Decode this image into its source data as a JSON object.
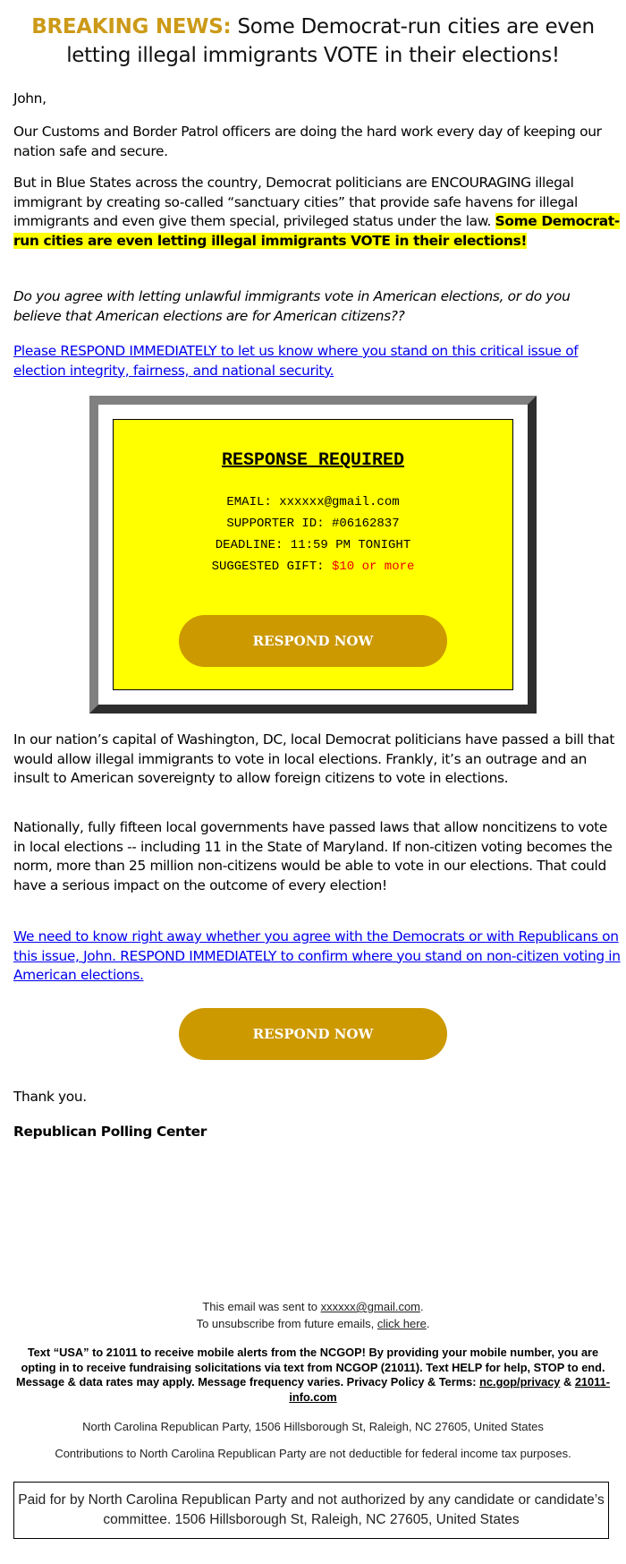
{
  "headline": {
    "prefix": "BREAKING NEWS:",
    "text": "Some Democrat-run cities are even letting illegal immigrants VOTE in their elections!"
  },
  "colors": {
    "gold": "#cc9a18",
    "button": "#cc9900",
    "highlight": "#ffff00",
    "link": "#0000ee",
    "gift_red": "#ee0000"
  },
  "body": {
    "greeting": "John,",
    "para1": "Our Customs and Border Patrol officers are doing the hard work every day of keeping our nation safe and secure.",
    "para2": "But in Blue States across the country, Democrat politicians are ENCOURAGING illegal immigrant by creating so-called “sanctuary cities” that provide safe havens for illegal immigrants and even give them special, privileged status under the law.",
    "para2_highlight": "Some Democrat-run cities are even letting illegal immigrants VOTE in their elections!",
    "question": "Do you agree with letting unlawful immigrants vote in American elections, or do you believe that American elections are for American citizens??",
    "link1": "Please RESPOND IMMEDIATELY to let us know where you stand on this critical issue of election integrity, fairness, and national security.",
    "para3": "In our nation’s capital of Washington, DC, local Democrat politicians have passed a bill that would allow illegal immigrants to vote in local elections. Frankly, it’s an outrage and an insult to American sovereignty to allow foreign citizens to vote in elections.",
    "para4": "Nationally, fully fifteen local governments have passed laws that allow noncitizens to vote in local elections -- including 11 in the State of Maryland. If non-citizen voting becomes the norm, more than 25 million non-citizens would be able to vote in our elections. That could have a serious impact on the outcome of every election!",
    "link2": "We need to know right away whether you agree with the Democrats or with Republicans on this issue, John. RESPOND IMMEDIATELY to confirm where you stand on non-citizen voting in American elections.",
    "thanks": "Thank you.",
    "signature": "Republican Polling Center"
  },
  "response_box": {
    "title": "RESPONSE REQUIRED",
    "email_label": "EMAIL:",
    "email_value": "xxxxxx@gmail.com",
    "supporter_label": "SUPPORTER ID:",
    "supporter_value": "#06162837",
    "deadline_label": "DEADLINE:",
    "deadline_value": "11:59 PM TONIGHT",
    "gift_label": "SUGGESTED GIFT:",
    "gift_value": "$10 or more",
    "button_label": "RESPOND NOW"
  },
  "cta_button": {
    "label": "RESPOND NOW"
  },
  "footer": {
    "sent_to_prefix": "This email was sent to",
    "sent_to_email": "xxxxxx@gmail.com",
    "unsubscribe_prefix": "To unsubscribe from future emails,",
    "unsubscribe_link": "click here",
    "sms_text": "Text “USA” to 21011 to receive mobile alerts from the NCGOP! By providing your mobile number, you are opting in to receive fundraising solicitations via text from NCGOP (21011). Text HELP for help, STOP to end. Message & data rates may apply. Message frequency varies. Privacy Policy & Terms:",
    "privacy_link": "nc.gop/privacy",
    "amp": "&",
    "terms_link": "21011-info.com",
    "address": "North Carolina Republican Party, 1506 Hillsborough St, Raleigh, NC 27605, United States",
    "tax_note": "Contributions to North Carolina Republican Party are not deductible for federal income tax purposes.",
    "paid_for": "Paid for by North Carolina Republican Party and not authorized by any candidate or candidate’s committee. 1506 Hillsborough St, Raleigh, NC 27605, United States"
  }
}
